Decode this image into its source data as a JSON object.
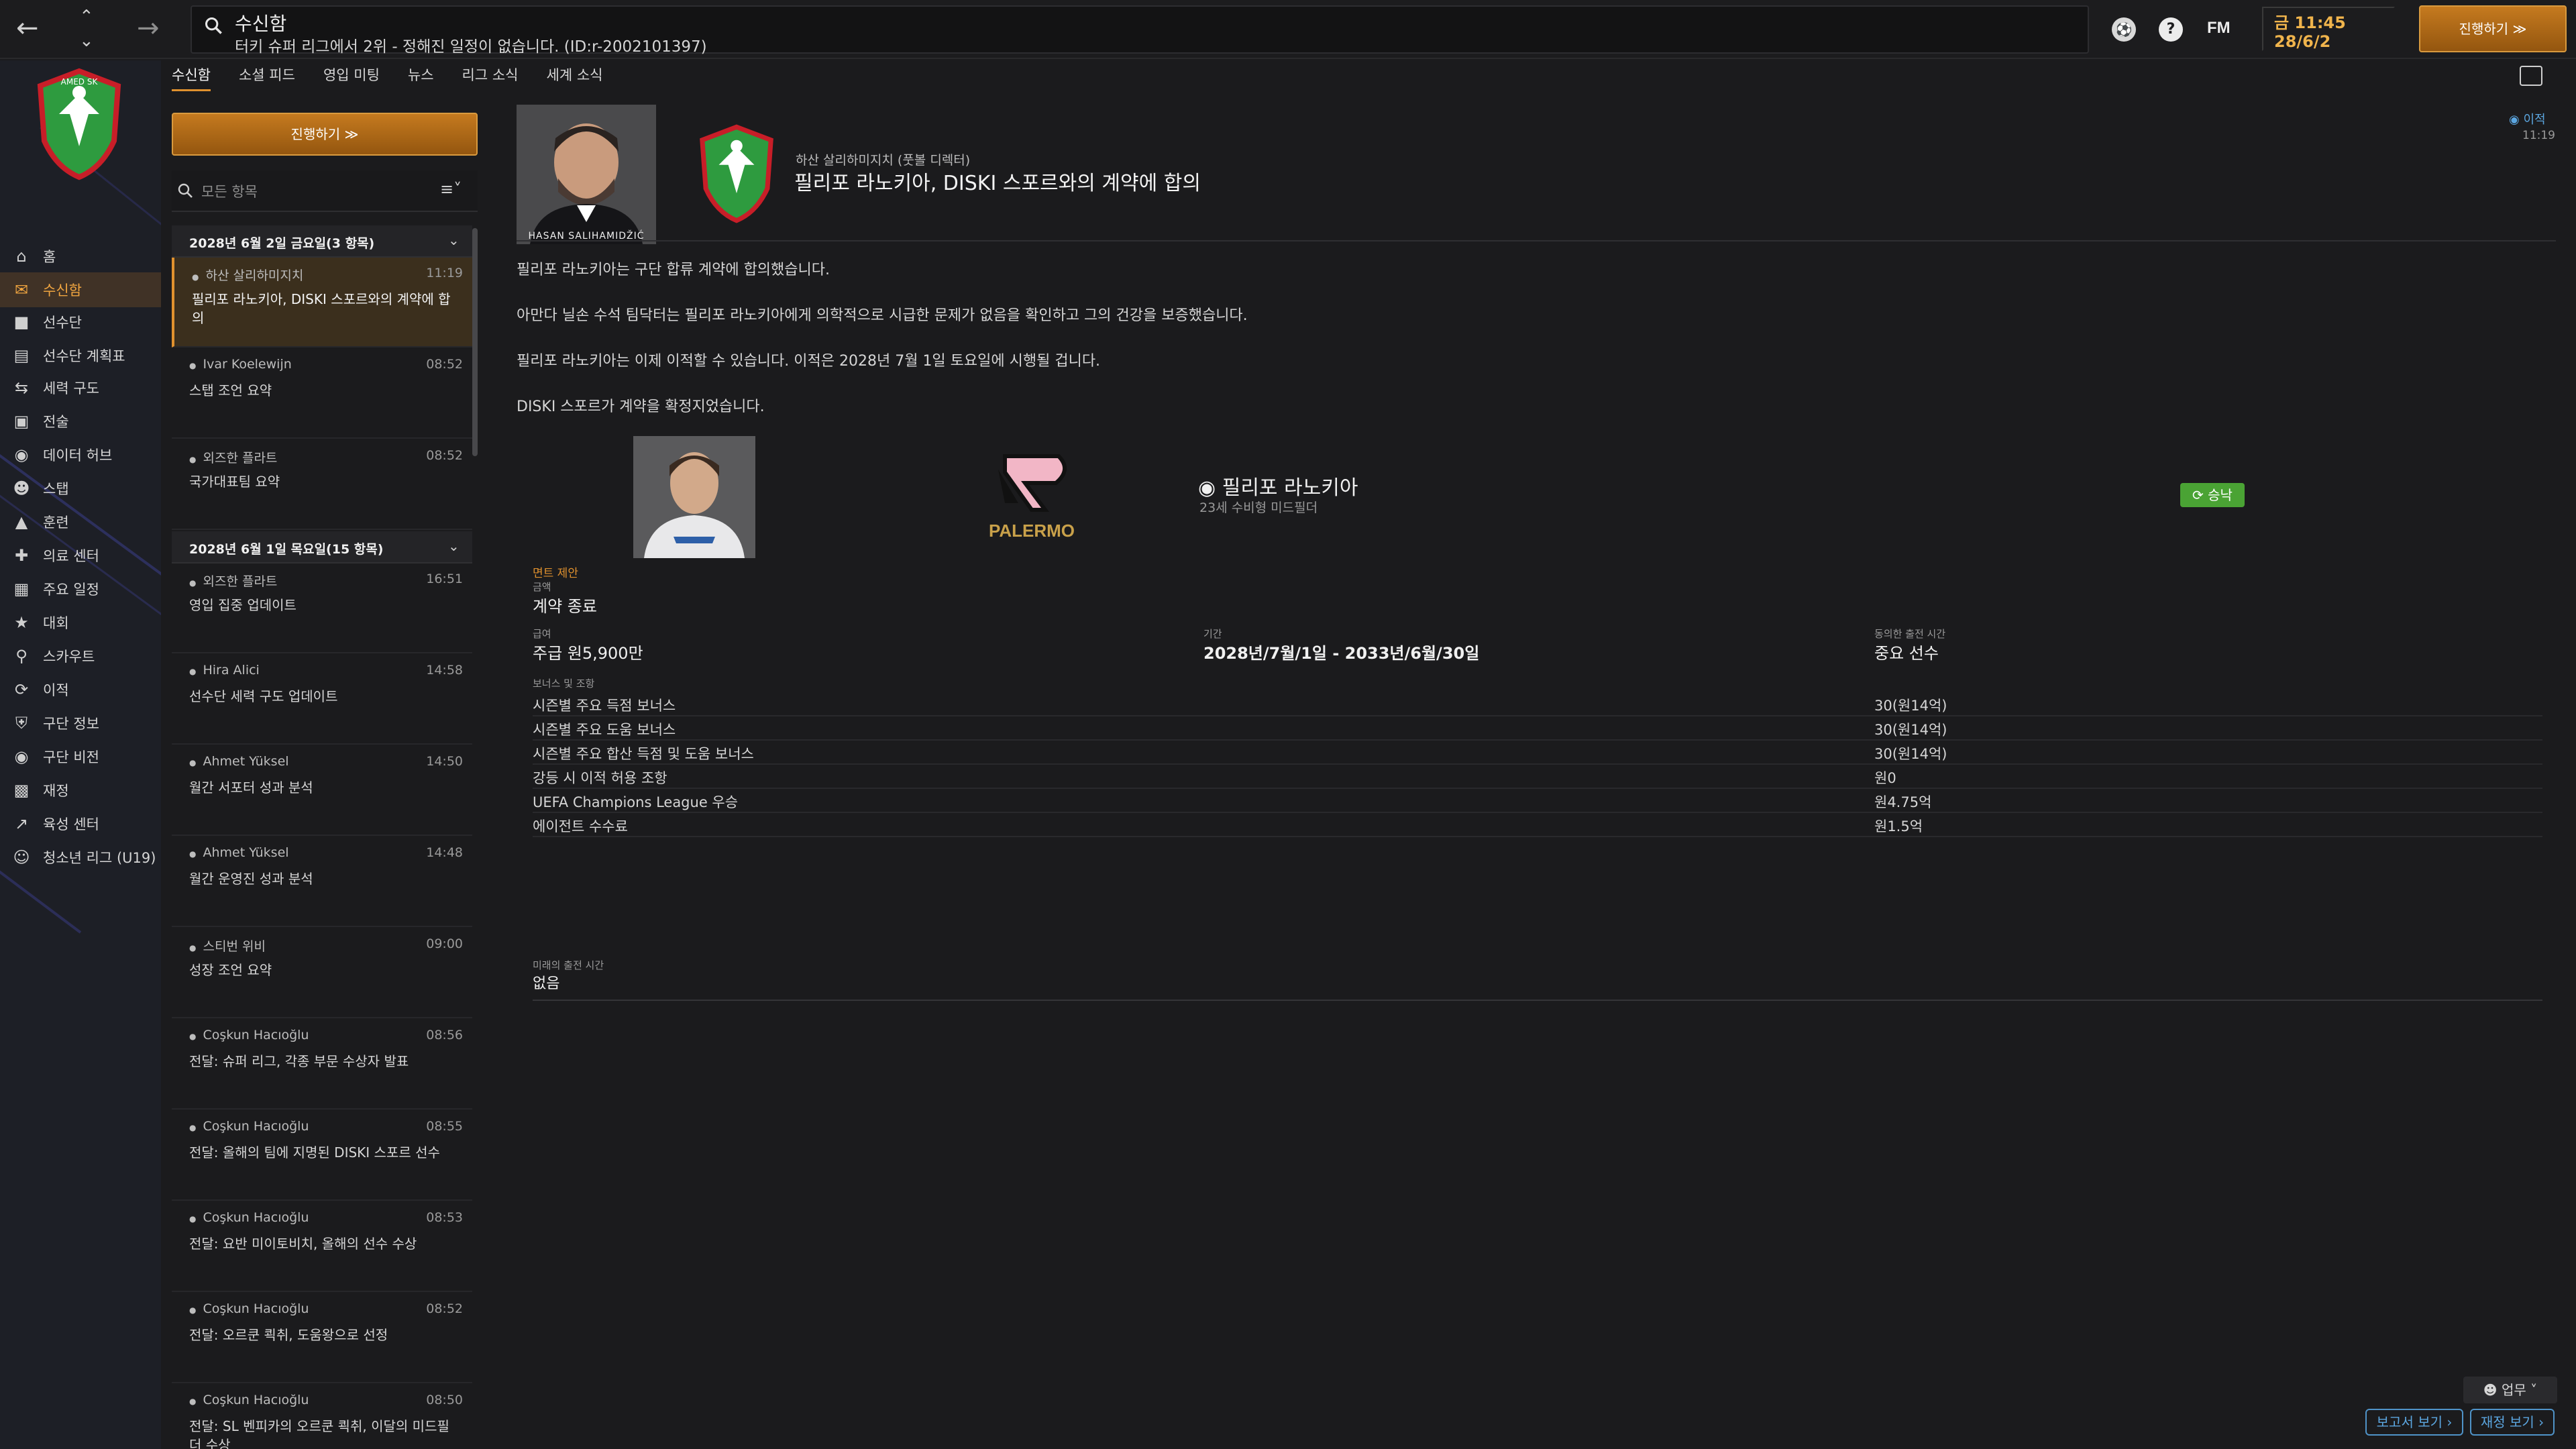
{
  "topbar": {
    "title": "수신함",
    "subtitle": "터키 슈퍼 리그에서 2위 - 정해진 일정이 없습니다. (ID:r-2002101397)",
    "fm_label": "FM",
    "time": "금 11:45",
    "date": "28/6/2",
    "continue_label": "진행하기 ≫"
  },
  "sidebar": {
    "items": [
      {
        "label": "홈",
        "icon": "home-icon"
      },
      {
        "label": "수신함",
        "icon": "inbox-icon"
      },
      {
        "label": "선수단",
        "icon": "shirt-icon"
      },
      {
        "label": "선수단 계획표",
        "icon": "clipboard-icon"
      },
      {
        "label": "세력 구도",
        "icon": "dynamics-icon"
      },
      {
        "label": "전술",
        "icon": "tactics-icon"
      },
      {
        "label": "데이터 허브",
        "icon": "data-icon"
      },
      {
        "label": "스탭",
        "icon": "staff-icon"
      },
      {
        "label": "훈련",
        "icon": "training-icon"
      },
      {
        "label": "의료 센터",
        "icon": "medical-icon"
      },
      {
        "label": "주요 일정",
        "icon": "calendar-icon"
      },
      {
        "label": "대회",
        "icon": "trophy-icon"
      },
      {
        "label": "스카우트",
        "icon": "scout-icon"
      },
      {
        "label": "이적",
        "icon": "transfer-icon"
      },
      {
        "label": "구단 정보",
        "icon": "club-icon"
      },
      {
        "label": "구단 비전",
        "icon": "vision-icon"
      },
      {
        "label": "재정",
        "icon": "finance-icon"
      },
      {
        "label": "육성 센터",
        "icon": "development-icon"
      },
      {
        "label": "청소년 리그 (U19)",
        "icon": "youth-icon"
      }
    ]
  },
  "tabs": [
    "수신함",
    "소셜 피드",
    "영입 미팅",
    "뉴스",
    "리그 소식",
    "세계 소식"
  ],
  "inbox": {
    "continue_label": "진행하기 ≫",
    "search_placeholder": "모든 항목",
    "groups": [
      {
        "label": "2028년 6월 2일 금요일(3 항목)"
      },
      {
        "label": "2028년 6월 1일 목요일(15 항목)"
      }
    ],
    "messages": [
      {
        "sender": "하산 살리하미지치",
        "time": "11:19",
        "subject": "필리포 라노키아, DISKI 스포르와의 계약에 합의"
      },
      {
        "sender": "Ivar Koelewijn",
        "time": "08:52",
        "subject": "스탭 조언 요약"
      },
      {
        "sender": "외즈한 플라트",
        "time": "08:52",
        "subject": "국가대표팀 요약"
      },
      {
        "sender": "외즈한 플라트",
        "time": "16:51",
        "subject": "영입 집중 업데이트"
      },
      {
        "sender": "Hira Alici",
        "time": "14:58",
        "subject": "선수단 세력 구도 업데이트"
      },
      {
        "sender": "Ahmet Yüksel",
        "time": "14:50",
        "subject": "월간 서포터 성과 분석"
      },
      {
        "sender": "Ahmet Yüksel",
        "time": "14:48",
        "subject": "월간 운영진 성과 분석"
      },
      {
        "sender": "스티번 위비",
        "time": "09:00",
        "subject": "성장 조언 요약"
      },
      {
        "sender": "Coşkun Hacıoğlu",
        "time": "08:56",
        "subject": "전달: 슈퍼 리그, 각종 부문 수상자 발표"
      },
      {
        "sender": "Coşkun Hacıoğlu",
        "time": "08:55",
        "subject": "전달: 올해의 팀에 지명된 DISKI 스포르 선수"
      },
      {
        "sender": "Coşkun Hacıoğlu",
        "time": "08:53",
        "subject": "전달: 요반 미이토비치, 올해의 선수 수상"
      },
      {
        "sender": "Coşkun Hacıoğlu",
        "time": "08:52",
        "subject": "전달: 오르쿤 쾩취, 도움왕으로 선정"
      },
      {
        "sender": "Coşkun Hacıoğlu",
        "time": "08:50",
        "subject": "전달: SL 벤피카의 오르쿤 쾩취, 이달의 미드필더 수상"
      }
    ]
  },
  "detail": {
    "photo_name": "HASAN SALIHAMIDŽIĆ",
    "sender": "하산 살리하미지치 (풋볼 디렉터)",
    "subject": "필리포 라노키아, DISKI 스포르와의 계약에 합의",
    "badge": "이적",
    "badge_time": "11:19",
    "paragraphs": [
      "필리포 라노키아는 구단 합류 계약에 합의했습니다.",
      "아만다 닐손 수석 팀닥터는 필리포 라노키아에게 의학적으로 시급한 문제가 없음을 확인하고 그의 건강을 보증했습니다.",
      "필리포 라노키아는 이제 이적할 수 있습니다. 이적은 2028년 7월 1일 토요일에 시행될 겁니다.",
      "DISKI 스포르가 계약을 확정지었습니다."
    ],
    "club_logo_text": "PALERMO",
    "player_name": "필리포 라노키아",
    "player_desc": "23세 수비형 미드필더",
    "status": "승낙",
    "contract": {
      "tag": "면트 제안",
      "fee_label": "금액",
      "fee_value": "계약 종료",
      "wage_label": "급여",
      "wage_value": "주급 원5,900만",
      "period_label": "기간",
      "period_value": "2028년/7월/1일 - 2033년/6월/30일",
      "time_label": "동의한 출전 시간",
      "time_value": "중요 선수",
      "bonus_header": "보너스 및 조항",
      "bonuses": [
        {
          "label": "시즌별 주요 득점 보너스",
          "value": "30(원14억)"
        },
        {
          "label": "시즌별 주요 도움 보너스",
          "value": "30(원14억)"
        },
        {
          "label": "시즌별 주요 합산 득점 및 도움 보너스",
          "value": "30(원14억)"
        },
        {
          "label": "강등 시 이적 허용 조항",
          "value": "원0"
        },
        {
          "label": "UEFA Champions League 우승",
          "value": "원4.75억"
        },
        {
          "label": "에이전트 수수료",
          "value": "원1.5억"
        }
      ],
      "future_label": "미래의 출전 시간",
      "future_value": "없음"
    }
  },
  "bottom": {
    "job_label": "업무",
    "report_label": "보고서 보기 ›",
    "finance_label": "재정 보기 ›"
  },
  "colors": {
    "accent": "#e0912e",
    "link": "#5ba6e0",
    "success": "#4aa334",
    "background": "#1b1b1d"
  }
}
